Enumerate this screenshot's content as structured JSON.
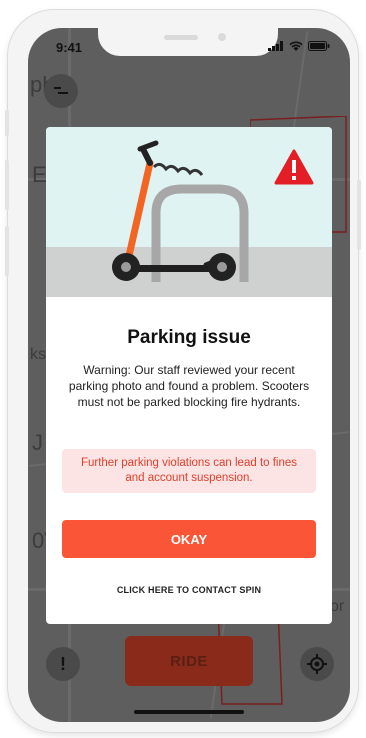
{
  "status_bar": {
    "time": "9:41"
  },
  "map": {
    "labels": [
      "ph ll",
      "E",
      "ks",
      "J",
      "0V",
      "or"
    ]
  },
  "controls": {
    "ride_label": "RIDE",
    "report_label": "!"
  },
  "modal": {
    "title": "Parking issue",
    "message": "Warning: Our staff reviewed your recent parking photo and found a problem. Scooters must not be parked blocking fire hydrants.",
    "alert": "Further parking violations can lead to fines and account suspension.",
    "okay_label": "OKAY",
    "contact_label": "CLICK HERE TO CONTACT SPIN"
  },
  "colors": {
    "accent": "#fa5537",
    "alert_bg": "#fde4e4",
    "alert_text": "#e0402c",
    "illustration_bg": "#dff3f3",
    "warning_icon": "#e41e26"
  },
  "icons": [
    "menu-icon",
    "warning-triangle-icon",
    "scooter-illustration",
    "signal-icon",
    "wifi-icon",
    "battery-icon",
    "locate-icon"
  ]
}
